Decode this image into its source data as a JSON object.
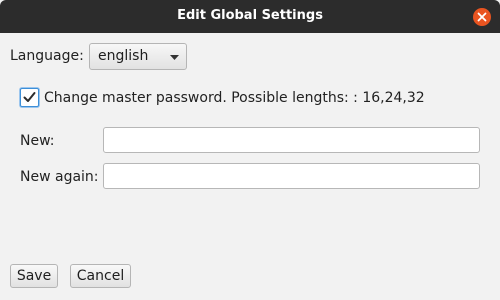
{
  "window": {
    "title": "Edit Global Settings",
    "close_icon": "close-icon",
    "accent_color": "#e95420"
  },
  "language": {
    "label": "Language:",
    "selected": "english",
    "arrow_icon": "caret-down-icon"
  },
  "master_password": {
    "checked": true,
    "label": "Change master password. Possible lengths: : 16,24,32",
    "new_label": "New:",
    "new_value": "",
    "new_again_label": "New again:",
    "new_again_value": ""
  },
  "buttons": {
    "save": "Save",
    "cancel": "Cancel"
  }
}
